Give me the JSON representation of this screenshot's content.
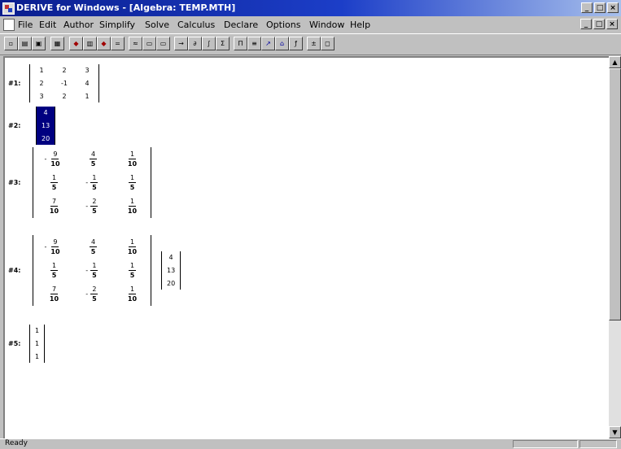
{
  "window": {
    "title": "DERIVE for Windows - [Algebra: TEMP.MTH]",
    "minimize": "_",
    "maximize": "□",
    "close": "×"
  },
  "menubar": {
    "items": [
      "File",
      "Edit",
      "Author",
      "Simplify",
      "Solve",
      "Calculus",
      "Declare",
      "Options",
      "Window",
      "Help"
    ]
  },
  "toolbar": {
    "button_icons": [
      "new-file-icon",
      "open-icon",
      "save-icon",
      "print-icon",
      "author-icon",
      "matrix-icon",
      "vector-icon",
      "simplify-icon",
      "approximate-icon",
      "solve-icon",
      "substitute-icon",
      "limit-icon",
      "derivative-icon",
      "integral-icon",
      "sum-icon",
      "product-icon",
      "taylor-icon",
      "2d-plot-icon",
      "3d-plot-icon",
      "factor-icon",
      "expand-icon",
      "graph-icon",
      "window-icon",
      "help-icon"
    ]
  },
  "expressions": [
    {
      "label": "#1:",
      "type": "matrix",
      "rows": [
        [
          "1",
          "2",
          "3"
        ],
        [
          "2",
          "-1",
          "4"
        ],
        [
          "3",
          "2",
          "1"
        ]
      ]
    },
    {
      "label": "#2:",
      "type": "vector",
      "selected": true,
      "values": [
        "4",
        "13",
        "20"
      ]
    },
    {
      "label": "#3:",
      "type": "fraction_matrix",
      "rows": [
        [
          {
            "sign": "-",
            "num": "9",
            "den": "10"
          },
          {
            "sign": "",
            "num": "4",
            "den": "5"
          },
          {
            "sign": "",
            "num": "1",
            "den": "10"
          }
        ],
        [
          {
            "sign": "",
            "num": "1",
            "den": "5"
          },
          {
            "sign": "-",
            "num": "1",
            "den": "5"
          },
          {
            "sign": "",
            "num": "1",
            "den": "5"
          }
        ],
        [
          {
            "sign": "",
            "num": "7",
            "den": "10"
          },
          {
            "sign": "-",
            "num": "2",
            "den": "5"
          },
          {
            "sign": "",
            "num": "1",
            "den": "10"
          }
        ]
      ]
    },
    {
      "label": "#4:",
      "type": "product",
      "rows": [
        [
          {
            "sign": "-",
            "num": "9",
            "den": "10"
          },
          {
            "sign": "",
            "num": "4",
            "den": "5"
          },
          {
            "sign": "",
            "num": "1",
            "den": "10"
          }
        ],
        [
          {
            "sign": "",
            "num": "1",
            "den": "5"
          },
          {
            "sign": "-",
            "num": "1",
            "den": "5"
          },
          {
            "sign": "",
            "num": "1",
            "den": "5"
          }
        ],
        [
          {
            "sign": "",
            "num": "7",
            "den": "10"
          },
          {
            "sign": "-",
            "num": "2",
            "den": "5"
          },
          {
            "sign": "",
            "num": "1",
            "den": "10"
          }
        ]
      ],
      "vector": [
        "4",
        "13",
        "20"
      ]
    },
    {
      "label": "#5:",
      "type": "vector",
      "values": [
        "1",
        "1",
        "1"
      ]
    }
  ],
  "statusbar": {
    "text": "Ready"
  }
}
